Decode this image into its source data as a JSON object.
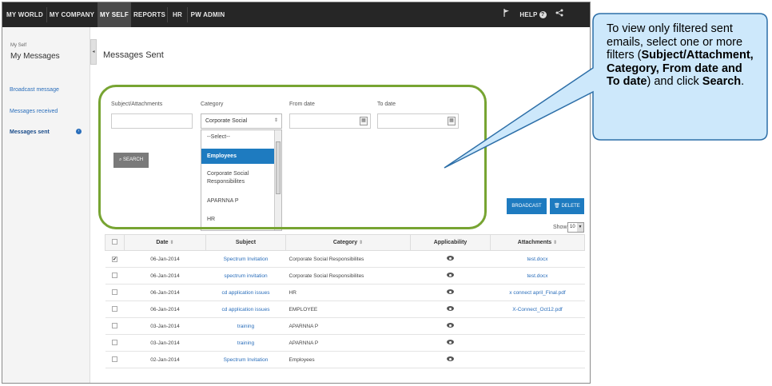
{
  "nav": {
    "items": [
      "MY WORLD",
      "MY COMPANY",
      "MY SELF",
      "REPORTS",
      "HR",
      "PW ADMIN"
    ],
    "help_label": "HELP",
    "help_glyph": "?"
  },
  "sidebar": {
    "crumb_small": "My Self",
    "crumb_title": "My Messages",
    "links": [
      "Broadcast message",
      "Messages received",
      "Messages sent"
    ],
    "active_bullet": "›"
  },
  "main": {
    "title": "Messages Sent"
  },
  "filters": {
    "subject_label": "Subject/Attachments",
    "category_label": "Category",
    "from_label": "From date",
    "to_label": "To date",
    "category_value": "Corporate Social",
    "search_label": "SEARCH",
    "dropdown_options": [
      "--Select--",
      "Employees",
      "Corporate Social Responsibilites",
      "APARNNA P",
      "HR"
    ],
    "selected_option": "Employees"
  },
  "actions": {
    "broadcast_label": "BROADCAST",
    "delete_label": "DELETE",
    "show_label": "Show:",
    "show_value": "10"
  },
  "table": {
    "headers": [
      "Date",
      "Subject",
      "Category",
      "Applicability",
      "Attachments"
    ],
    "rows": [
      {
        "checked": true,
        "date": "06-Jan-2014",
        "subject": "Spectrum Invitation",
        "category": "Corporate Social Responsibilites",
        "attachment": "test.docx"
      },
      {
        "checked": false,
        "date": "06-Jan-2014",
        "subject": "spectrum invitation",
        "category": "Corporate Social Responsibilites",
        "attachment": "test.docx"
      },
      {
        "checked": false,
        "date": "06-Jan-2014",
        "subject": "cd application issues",
        "category": "HR",
        "attachment": "x connect april_Final.pdf"
      },
      {
        "checked": false,
        "date": "06-Jan-2014",
        "subject": "cd application issues",
        "category": "EMPLOYEE",
        "attachment": "X-Connect_Oct12.pdf"
      },
      {
        "checked": false,
        "date": "03-Jan-2014",
        "subject": "training",
        "category": "APARNNA P",
        "attachment": ""
      },
      {
        "checked": false,
        "date": "03-Jan-2014",
        "subject": "training",
        "category": "APARNNA P",
        "attachment": ""
      },
      {
        "checked": false,
        "date": "02-Jan-2014",
        "subject": "Spectrum Invitation",
        "category": "Employees",
        "attachment": ""
      }
    ]
  },
  "callout": {
    "line1": "To view only filtered sent emails, select one or more filters (",
    "bold1": "Subject/Attachment, Category, From date and To date",
    "line2": ") and click ",
    "bold2": "Search",
    "line3": "."
  },
  "colors": {
    "nav_bg": "#262626",
    "accent": "#1e7bc0",
    "highlight": "#77a432",
    "callout_fill": "#cde8fb",
    "callout_border": "#2d6fa8"
  }
}
